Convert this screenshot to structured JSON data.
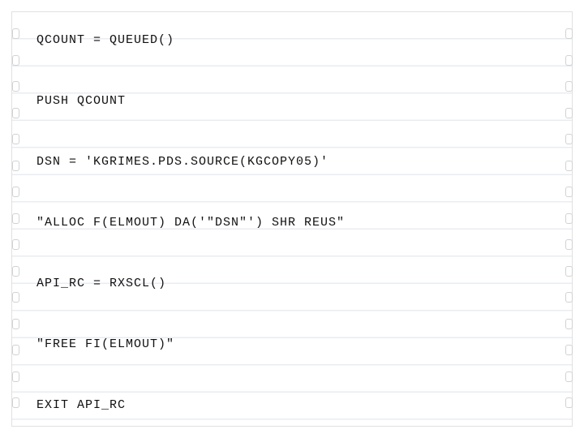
{
  "code": {
    "lines": [
      "QCOUNT = QUEUED()",
      "",
      "PUSH QCOUNT",
      "",
      "DSN = 'KGRIMES.PDS.SOURCE(KGCOPY05)'",
      "",
      "\"ALLOC F(ELMOUT) DA('\"DSN\"') SHR REUS\"",
      "",
      "API_RC = RXSCL()",
      "",
      "\"FREE FI(ELMOUT)\"",
      "",
      "EXIT API_RC"
    ]
  }
}
